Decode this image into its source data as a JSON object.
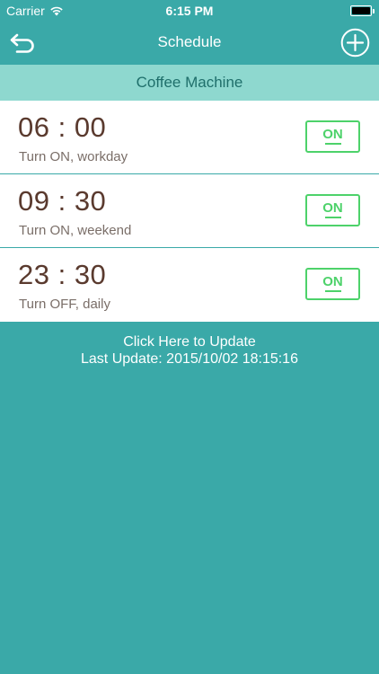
{
  "status_bar": {
    "carrier": "Carrier",
    "time": "6:15 PM",
    "icons": [
      "wifi-icon",
      "battery-icon"
    ]
  },
  "nav": {
    "title": "Schedule",
    "back_icon": "back-arrow-icon",
    "add_icon": "plus-circle-icon"
  },
  "device": {
    "name": "Coffee Machine"
  },
  "schedules": [
    {
      "time": "06 : 00",
      "description": "Turn ON, workday",
      "toggle": "ON"
    },
    {
      "time": "09 : 30",
      "description": "Turn ON, weekend",
      "toggle": "ON"
    },
    {
      "time": "23 : 30",
      "description": "Turn OFF, daily",
      "toggle": "ON"
    }
  ],
  "update": {
    "link_text": "Click Here to Update",
    "last_update": "Last Update: 2015/10/02 18:15:16"
  },
  "colors": {
    "background": "#3aa9a8",
    "device_bar": "#8ed8cf",
    "toggle_on": "#4dd26a",
    "time_text": "#5a3a2e"
  }
}
